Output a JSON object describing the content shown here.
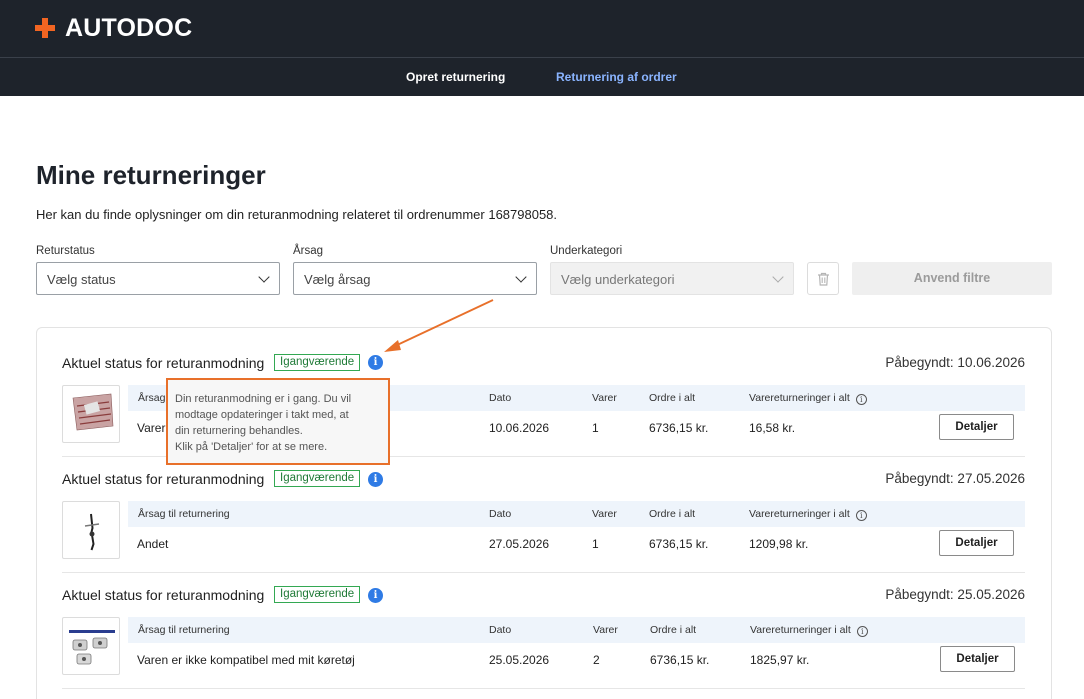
{
  "header": {
    "logo_text": "AUTODOC",
    "brand_color": "#f26522",
    "tabs": [
      {
        "label": "Opret returnering"
      },
      {
        "label": "Returnering af ordrer",
        "active": true
      }
    ]
  },
  "page": {
    "title": "Mine returneringer",
    "intro": "Her kan du finde oplysninger om din returanmodning relateret til ordrenummer 168798058."
  },
  "filters": {
    "status": {
      "label": "Returstatus",
      "value": "Vælg status"
    },
    "reason": {
      "label": "Årsag",
      "value": "Vælg årsag"
    },
    "subcategory": {
      "label": "Underkategori",
      "value": "Vælg underkategori",
      "disabled": true
    },
    "apply_label": "Anvend filtre",
    "clear_icon": "trash-icon"
  },
  "columns": {
    "reason": "Årsag til returnering",
    "date": "Dato",
    "items": "Varer",
    "order_total": "Ordre i alt",
    "return_total": "Varereturneringer i alt"
  },
  "returns": [
    {
      "heading": "Aktuel status for returanmodning",
      "status": "Igangværende",
      "started": "Påbegyndt: 10.06.2026",
      "reason_header": "Årsag",
      "reason": "Varer",
      "date": "10.06.2026",
      "items": "1",
      "order_total": "6736,15 kr.",
      "return_total": "16,58 kr.",
      "details_label": "Detaljer"
    },
    {
      "heading": "Aktuel status for returanmodning",
      "status": "Igangværende",
      "started": "Påbegyndt: 27.05.2026",
      "reason_header": "Årsag til returnering",
      "reason": "Andet",
      "date": "27.05.2026",
      "items": "1",
      "order_total": "6736,15 kr.",
      "return_total": "1209,98 kr.",
      "details_label": "Detaljer"
    },
    {
      "heading": "Aktuel status for returanmodning",
      "status": "Igangværende",
      "started": "Påbegyndt: 25.05.2026",
      "reason_header": "Årsag til returnering",
      "reason": "Varen er ikke kompatibel med mit køretøj",
      "date": "25.05.2026",
      "items": "2",
      "order_total": "6736,15 kr.",
      "return_total": "1825,97 kr.",
      "details_label": "Detaljer"
    }
  ],
  "tooltip": {
    "lines": [
      "Din returanmodning er i gang. Du vil",
      "modtage opdateringer i takt med, at",
      "din returnering behandles.",
      "Klik på 'Detaljer' for at se mere."
    ],
    "highlight_color": "#e8702a"
  },
  "colors": {
    "header_bg": "#1e232b",
    "active_tab": "#8ab4ff",
    "status_green": "#33a852",
    "info_blue": "#2f7be5"
  }
}
